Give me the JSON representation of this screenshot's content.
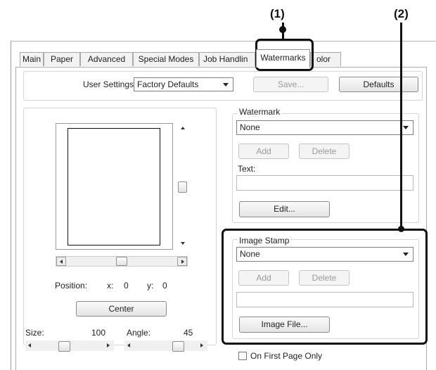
{
  "callouts": {
    "one": "(1)",
    "two": "(2)"
  },
  "tabs": [
    {
      "label": "Main"
    },
    {
      "label": "Paper"
    },
    {
      "label": "Advanced"
    },
    {
      "label": "Special Modes"
    },
    {
      "label": "Job Handlin"
    },
    {
      "label": "Watermarks"
    },
    {
      "label": "olor"
    }
  ],
  "user_settings": {
    "label": "User Settings:",
    "value": "Factory Defaults",
    "save_label": "Save...",
    "defaults_label": "Defaults"
  },
  "position": {
    "label": "Position:",
    "x_label": "x:",
    "x_value": "0",
    "y_label": "y:",
    "y_value": "0",
    "center_label": "Center"
  },
  "size": {
    "label": "Size:",
    "value": "100"
  },
  "angle": {
    "label": "Angle:",
    "value": "45"
  },
  "watermark": {
    "group_label": "Watermark",
    "select_value": "None",
    "add_label": "Add",
    "delete_label": "Delete",
    "text_label": "Text:",
    "text_value": "",
    "edit_label": "Edit..."
  },
  "image_stamp": {
    "group_label": "Image Stamp",
    "select_value": "None",
    "add_label": "Add",
    "delete_label": "Delete",
    "path_value": "",
    "image_file_label": "Image File..."
  },
  "first_page_only": {
    "label": "On First Page Only",
    "checked": false
  },
  "colors": {
    "highlight": "#111111",
    "panel_border": "#a9a9a9",
    "disabled_text": "#9a9a9a"
  }
}
